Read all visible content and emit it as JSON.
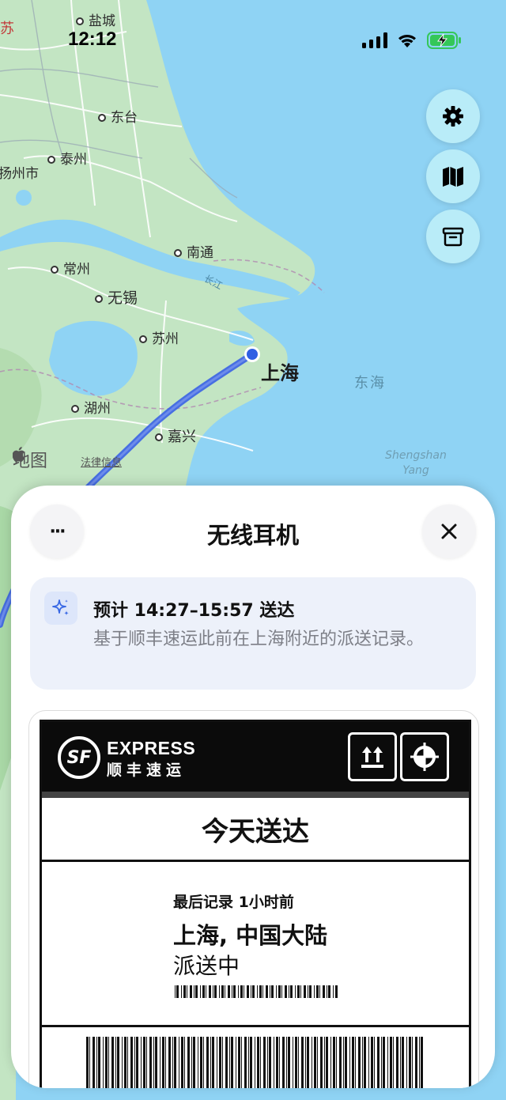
{
  "status": {
    "time": "12:12"
  },
  "map": {
    "cities": [
      {
        "id": "yancheng",
        "name": "盐城",
        "big": false
      },
      {
        "id": "dongtai",
        "name": "东台",
        "big": false
      },
      {
        "id": "taizhou",
        "name": "泰州",
        "big": false
      },
      {
        "id": "yangzhou",
        "name": "扬州市",
        "big": false
      },
      {
        "id": "nantong",
        "name": "南通",
        "big": false
      },
      {
        "id": "changzhou",
        "name": "常州",
        "big": false
      },
      {
        "id": "wuxi",
        "name": "无锡",
        "big": false
      },
      {
        "id": "suzhou",
        "name": "苏州",
        "big": false
      },
      {
        "id": "huzhou",
        "name": "湖州",
        "big": false
      },
      {
        "id": "jiaxing",
        "name": "嘉兴",
        "big": false
      },
      {
        "id": "shanghai",
        "name": "上海",
        "big": true
      }
    ],
    "province_label": "苏",
    "river_label": "长江",
    "sea_label": "东海",
    "sea_en_line1": "Shengshan",
    "sea_en_line2": "Yang",
    "maps_logo": "地图",
    "legal_link": "法律信息"
  },
  "sheet": {
    "title": "无线耳机",
    "more_label": "···",
    "eta": {
      "title": "预计 14:27–15:57 送达",
      "description": "基于顺丰速运此前在上海附近的派送记录。"
    },
    "label": {
      "brand_logo_text": "SF",
      "brand_en": "EXPRESS",
      "brand_cn": "顺丰速运",
      "delivery_day": "今天送达",
      "last_record": "最后记录  1小时前",
      "location": "上海, 中国大陆",
      "state": "派送中"
    }
  },
  "colors": {
    "route": "#3a62e6",
    "sea": "#8fd3f4",
    "land": "#c3e5c3",
    "fab_bg": "#b9ecf8"
  }
}
